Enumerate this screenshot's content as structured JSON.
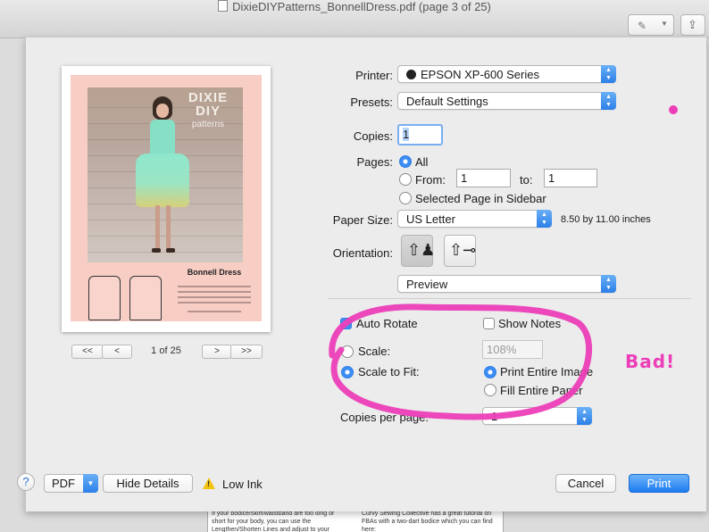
{
  "window": {
    "title": "DixieDIYPatterns_BonnellDress.pdf (page 3 of 25)"
  },
  "preview": {
    "page_indicator": "1 of 25",
    "first_page": "<<",
    "prev_page": "<",
    "next_page": ">",
    "last_page": ">>",
    "thumbnail": {
      "logo_line1": "DIXIE DIY",
      "logo_line2": "patterns",
      "pattern_title": "Bonnell Dress"
    }
  },
  "form": {
    "printer_label": "Printer:",
    "printer_value": "EPSON XP-600 Series",
    "presets_label": "Presets:",
    "presets_value": "Default Settings",
    "copies_label": "Copies:",
    "copies_value": "1",
    "pages_label": "Pages:",
    "pages_all": "All",
    "pages_from_label": "From:",
    "pages_from_value": "1",
    "pages_to_label": "to:",
    "pages_to_value": "1",
    "pages_selected": "Selected Page in Sidebar",
    "paper_size_label": "Paper Size:",
    "paper_size_value": "US Letter",
    "paper_size_dims": "8.50 by 11.00 inches",
    "orientation_label": "Orientation:",
    "section_value": "Preview",
    "auto_rotate_label": "Auto Rotate",
    "show_notes_label": "Show Notes",
    "scale_label": "Scale:",
    "scale_value": "108%",
    "scale_to_fit_label": "Scale to Fit:",
    "print_entire_image": "Print Entire Image",
    "fill_entire_paper": "Fill Entire Paper",
    "copies_per_page_label": "Copies per page:",
    "copies_per_page_value": "1"
  },
  "footer": {
    "help": "?",
    "pdf_label": "PDF",
    "hide_details": "Hide Details",
    "low_ink": "Low Ink",
    "cancel": "Cancel",
    "print": "Print"
  },
  "annotation": {
    "text": "Bad!",
    "color": "#ec3eb8"
  },
  "icons": {
    "document": "pdf-document-icon",
    "annotate": "markup-pen-icon",
    "share": "share-icon",
    "printer": "printer-icon",
    "warning": "warning-triangle-icon"
  }
}
